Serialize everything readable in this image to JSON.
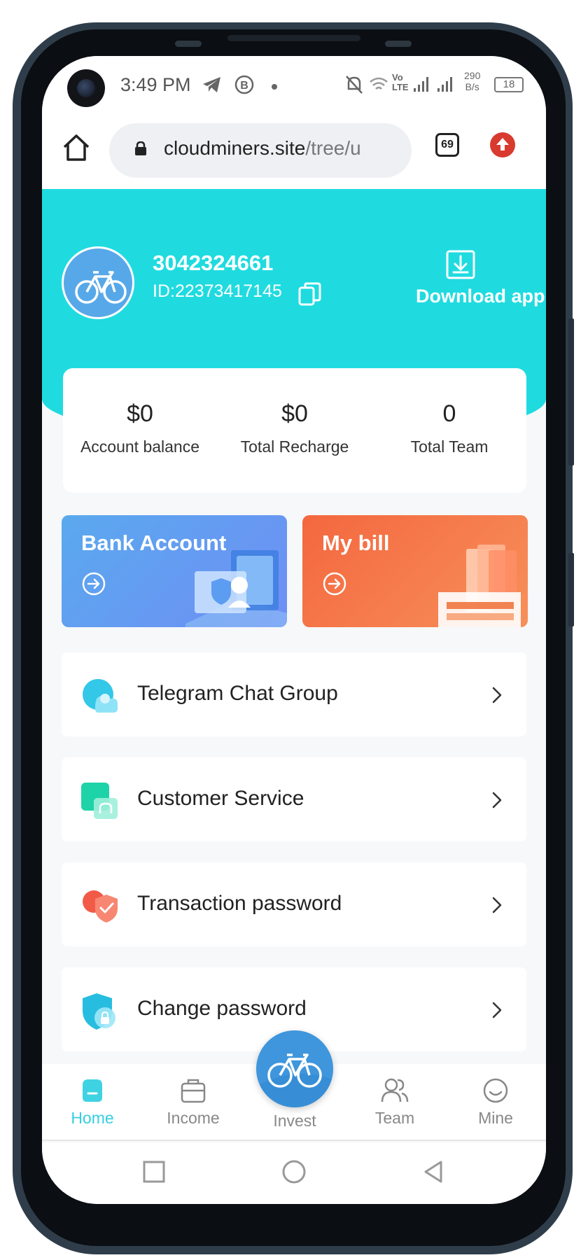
{
  "status_bar": {
    "time": "3:49 PM",
    "icons": [
      "telegram-icon",
      "b-icon",
      "dot-icon"
    ],
    "net_speed_value": "290",
    "net_speed_unit": "B/s",
    "volte": "Vo LTE",
    "battery": "18"
  },
  "browser": {
    "url_host": "cloudminers.site",
    "url_path": "/tree/u",
    "tabs_count": "69"
  },
  "profile": {
    "username": "3042324661",
    "user_id": "ID:22373417145",
    "download_label": "Download app"
  },
  "stats": [
    {
      "value": "$0",
      "label": "Account balance"
    },
    {
      "value": "$0",
      "label": "Total Recharge"
    },
    {
      "value": "0",
      "label": "Total Team"
    }
  ],
  "cards": {
    "bank": "Bank Account",
    "bill": "My bill"
  },
  "menu": [
    {
      "label": "Telegram Chat Group",
      "icon": "chat-group-icon"
    },
    {
      "label": "Customer Service",
      "icon": "customer-service-icon"
    },
    {
      "label": "Transaction password",
      "icon": "transaction-password-icon"
    },
    {
      "label": "Change password",
      "icon": "change-password-icon"
    }
  ],
  "bottom_nav": {
    "home": "Home",
    "income": "Income",
    "invest": "Invest",
    "team": "Team",
    "mine": "Mine"
  },
  "colors": {
    "header": "#1fdbe0",
    "active_nav": "#34cfe0",
    "bank_card": "#5aa9ee",
    "bill_card": "#f4673f"
  }
}
